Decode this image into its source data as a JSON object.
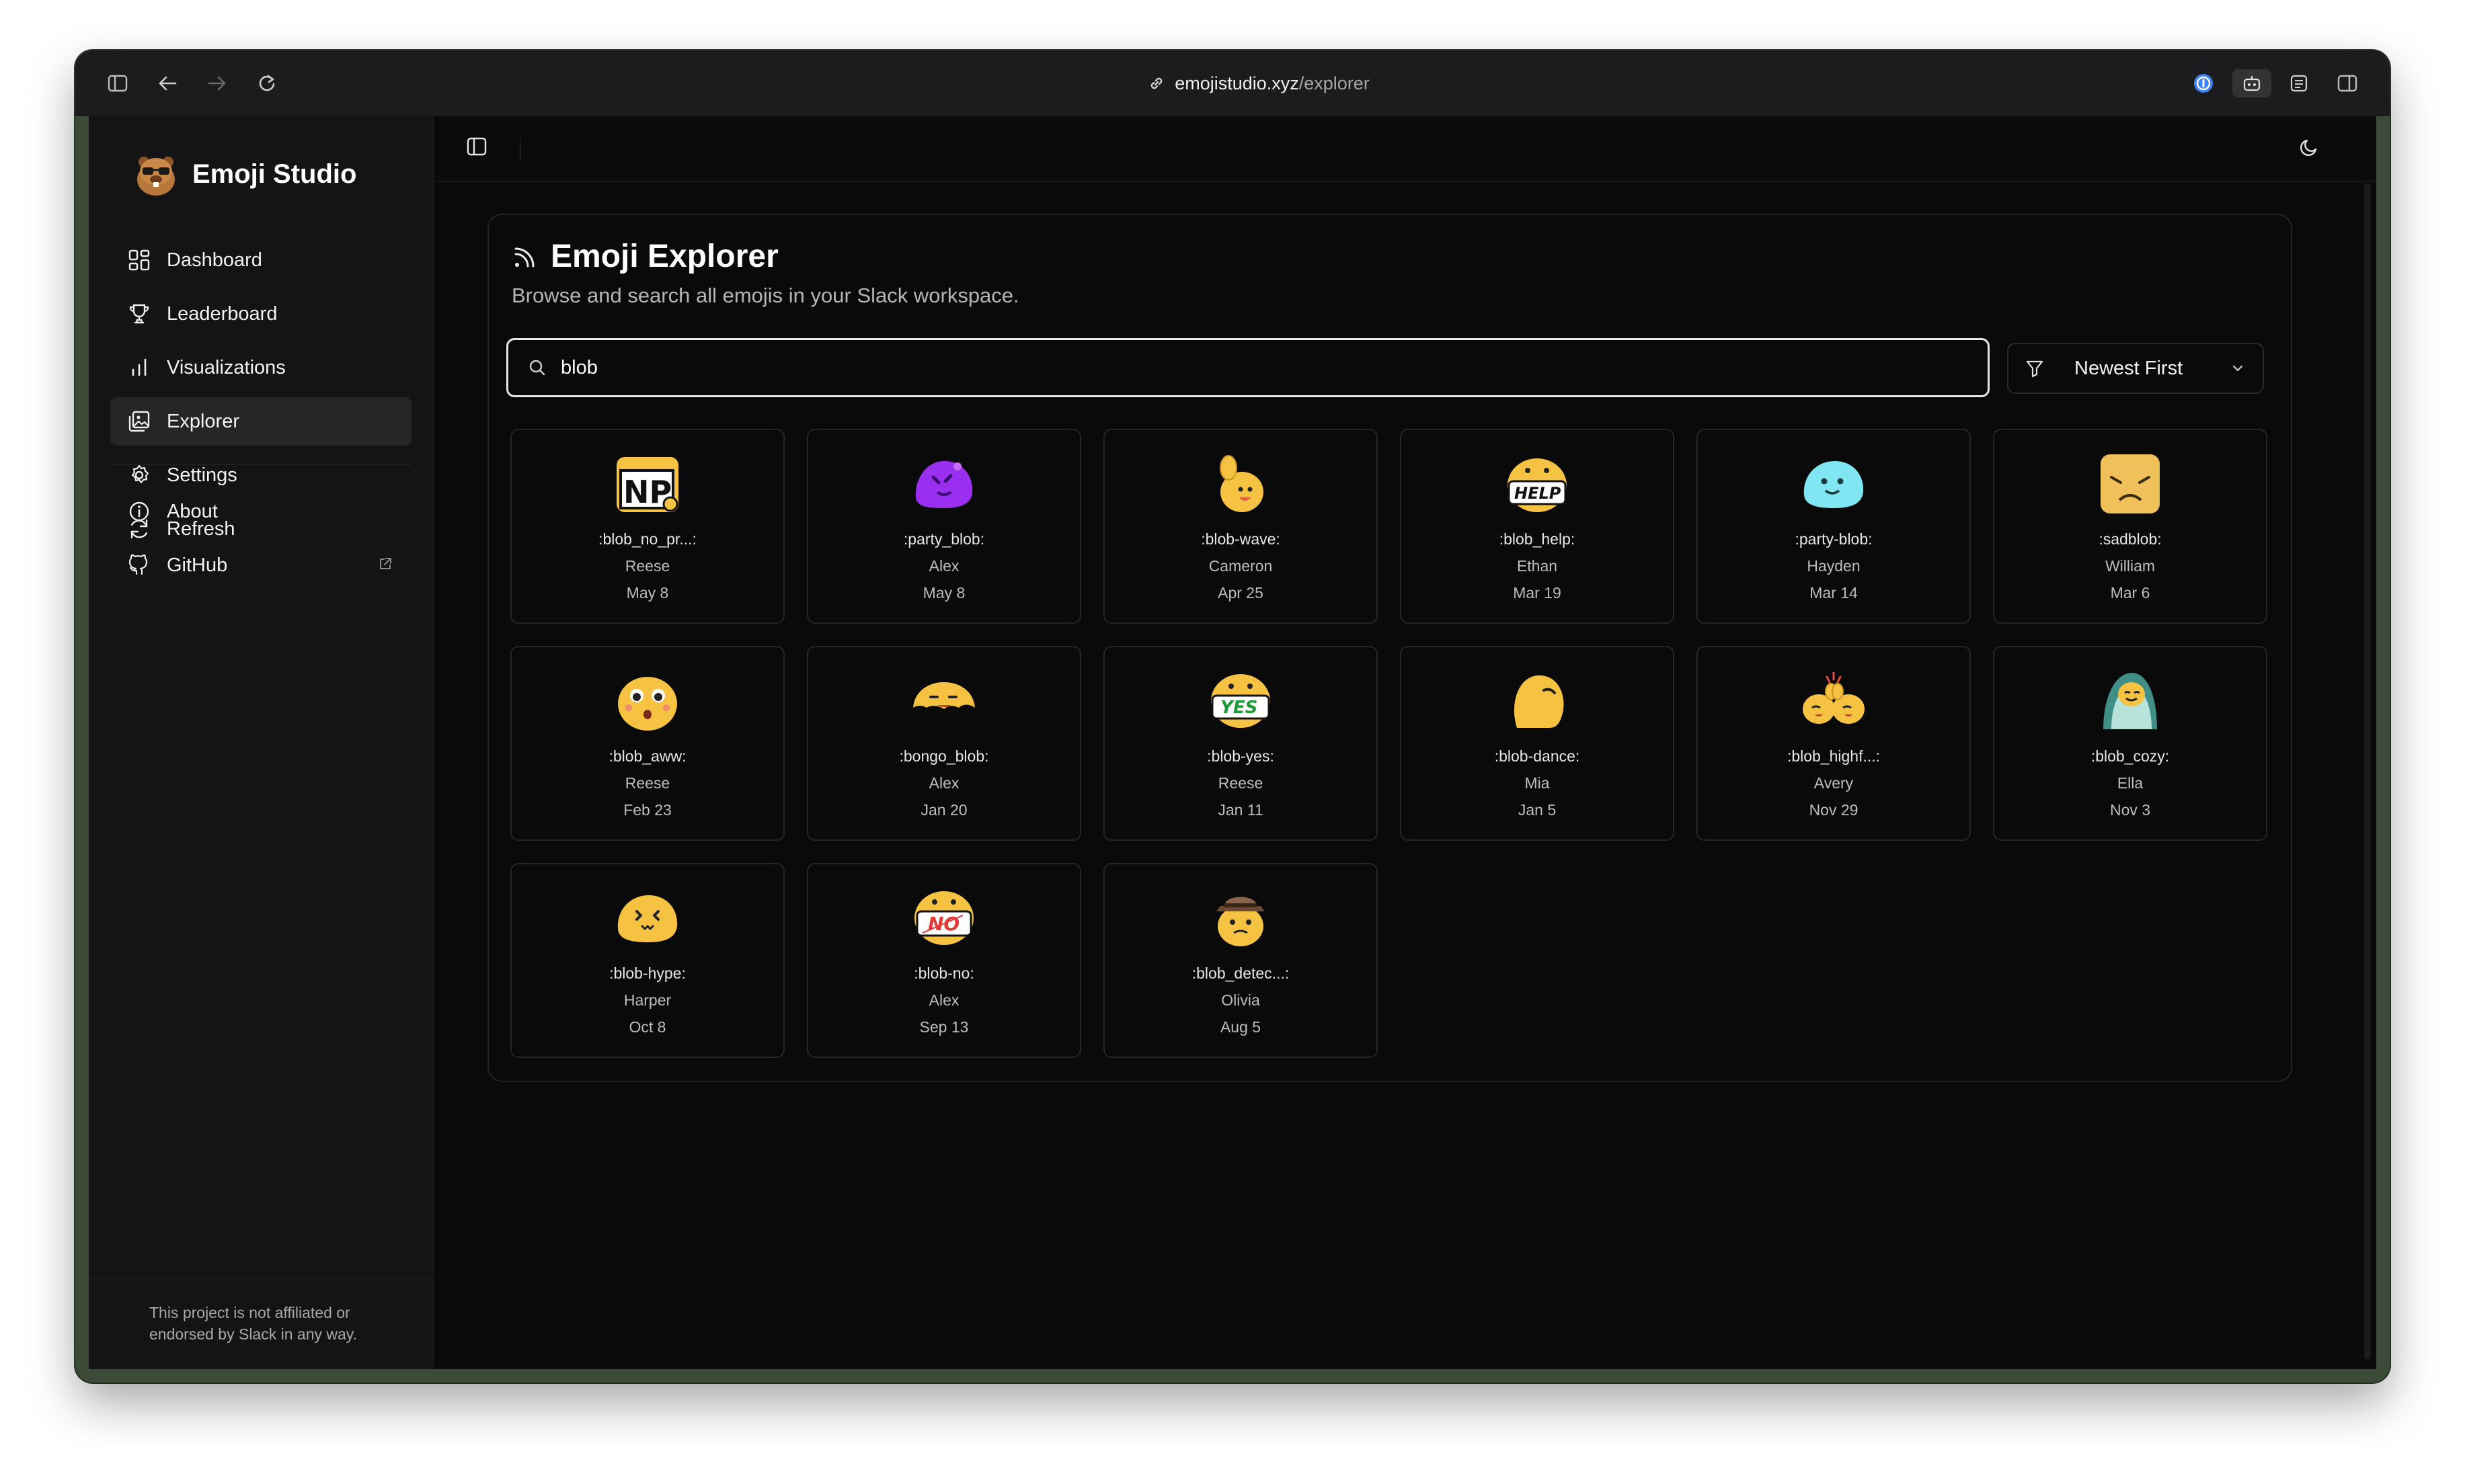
{
  "browser": {
    "url_domain": "emojistudio.xyz",
    "url_path": "/explorer"
  },
  "sidebar": {
    "brand": "Emoji Studio",
    "items": [
      {
        "label": "Dashboard",
        "icon": "dashboard-icon"
      },
      {
        "label": "Leaderboard",
        "icon": "trophy-icon"
      },
      {
        "label": "Visualizations",
        "icon": "bar-chart-icon"
      },
      {
        "label": "Explorer",
        "icon": "image-gallery-icon"
      },
      {
        "label": "Settings",
        "icon": "gear-icon"
      },
      {
        "label": "Refresh",
        "icon": "refresh-icon"
      }
    ],
    "secondary": [
      {
        "label": "About",
        "icon": "info-icon"
      },
      {
        "label": "GitHub",
        "icon": "github-icon"
      }
    ],
    "footer": "This project is not affiliated or endorsed by Slack in any way."
  },
  "page": {
    "title": "Emoji Explorer",
    "subtitle": "Browse and search all emojis in your Slack workspace.",
    "search_value": "blob",
    "sort_label": "Newest First"
  },
  "emojis": [
    {
      "name": ":blob_no_pr...:",
      "user": "Reese",
      "date": "May 8",
      "icon": "np-sign-icon"
    },
    {
      "name": ":party_blob:",
      "user": "Alex",
      "date": "May 8",
      "icon": "purple-blob-icon"
    },
    {
      "name": ":blob-wave:",
      "user": "Cameron",
      "date": "Apr 25",
      "icon": "waving-blob-icon"
    },
    {
      "name": ":blob_help:",
      "user": "Ethan",
      "date": "Mar 19",
      "icon": "help-sign-blob-icon"
    },
    {
      "name": ":party-blob:",
      "user": "Hayden",
      "date": "Mar 14",
      "icon": "cyan-blob-icon"
    },
    {
      "name": ":sadblob:",
      "user": "William",
      "date": "Mar 6",
      "icon": "sad-blob-icon"
    },
    {
      "name": ":blob_aww:",
      "user": "Reese",
      "date": "Feb 23",
      "icon": "aww-blob-icon"
    },
    {
      "name": ":bongo_blob:",
      "user": "Alex",
      "date": "Jan 20",
      "icon": "bongo-blob-icon"
    },
    {
      "name": ":blob-yes:",
      "user": "Reese",
      "date": "Jan 11",
      "icon": "yes-sign-blob-icon"
    },
    {
      "name": ":blob-dance:",
      "user": "Mia",
      "date": "Jan 5",
      "icon": "dancing-blob-icon"
    },
    {
      "name": ":blob_highf...:",
      "user": "Avery",
      "date": "Nov 29",
      "icon": "highfive-blob-icon"
    },
    {
      "name": ":blob_cozy:",
      "user": "Ella",
      "date": "Nov 3",
      "icon": "cozy-blob-icon"
    },
    {
      "name": ":blob-hype:",
      "user": "Harper",
      "date": "Oct 8",
      "icon": "hype-blob-icon"
    },
    {
      "name": ":blob-no:",
      "user": "Alex",
      "date": "Sep 13",
      "icon": "no-sign-blob-icon"
    },
    {
      "name": ":blob_detec...:",
      "user": "Olivia",
      "date": "Aug 5",
      "icon": "detective-blob-icon"
    }
  ],
  "colors": {
    "background": "#0a0a0a",
    "sidebar": "#141414",
    "accent_blob": "#f5c242",
    "border": "#262626"
  }
}
